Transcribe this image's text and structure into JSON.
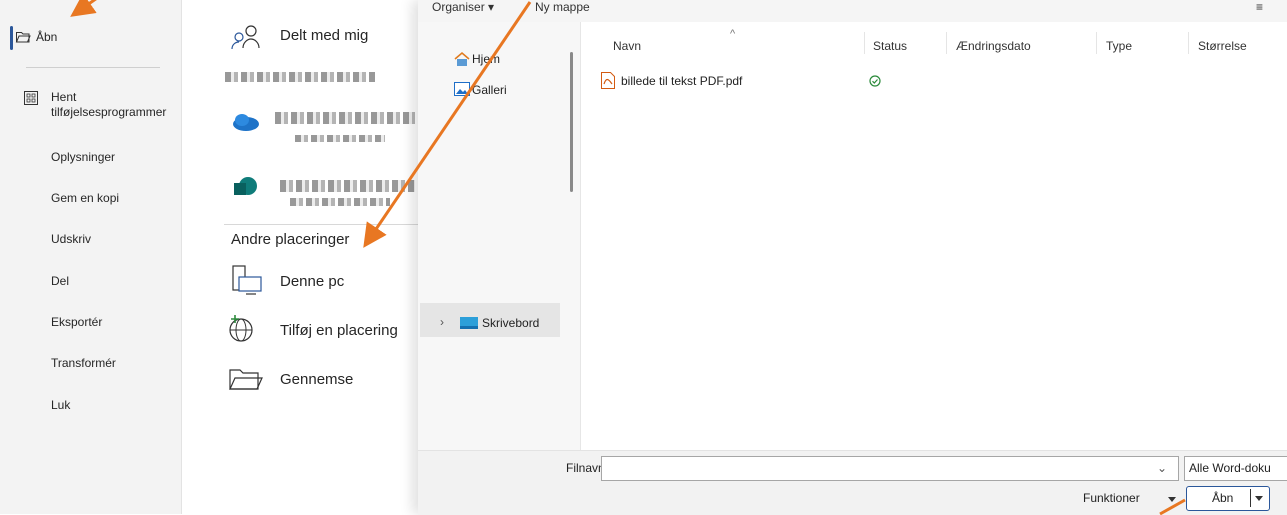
{
  "nav": {
    "items": [
      {
        "label": "Åbn",
        "icon": "folder-open-icon",
        "active": true
      },
      {
        "label": "Hent\ntilføjelsesprogrammer",
        "icon": "addins-icon"
      },
      {
        "label": "Oplysninger"
      },
      {
        "label": "Gem en kopi"
      },
      {
        "label": "Udskriv"
      },
      {
        "label": "Del"
      },
      {
        "label": "Eksportér"
      },
      {
        "label": "Transformér"
      },
      {
        "label": "Luk"
      }
    ]
  },
  "locations": {
    "shared": "Delt med mig",
    "other_header": "Andre placeringer",
    "this_pc": "Denne pc",
    "add_place": "Tilføj en placering",
    "browse": "Gennemse"
  },
  "dialog": {
    "toolbar": {
      "organize": "Organiser ▾",
      "new_folder": "Ny mappe",
      "view_icon": "view-menu-icon"
    },
    "tree": {
      "home": "Hjem",
      "gallery": "Galleri",
      "desktop": "Skrivebord"
    },
    "columns": {
      "name": "Navn",
      "status": "Status",
      "date": "Ændringsdato",
      "type": "Type",
      "size": "Størrelse"
    },
    "files": [
      {
        "name": "billede til tekst PDF.pdf",
        "status_icon": "synced-check-icon"
      }
    ],
    "bottom": {
      "filename_label": "Filnavn:",
      "filename_value": "",
      "filter_value": "Alle Word-doku",
      "tools_label": "Funktioner",
      "open_label": "Åbn"
    }
  },
  "colors": {
    "annotation_arrow": "#e87722",
    "accent": "#2b579a"
  }
}
